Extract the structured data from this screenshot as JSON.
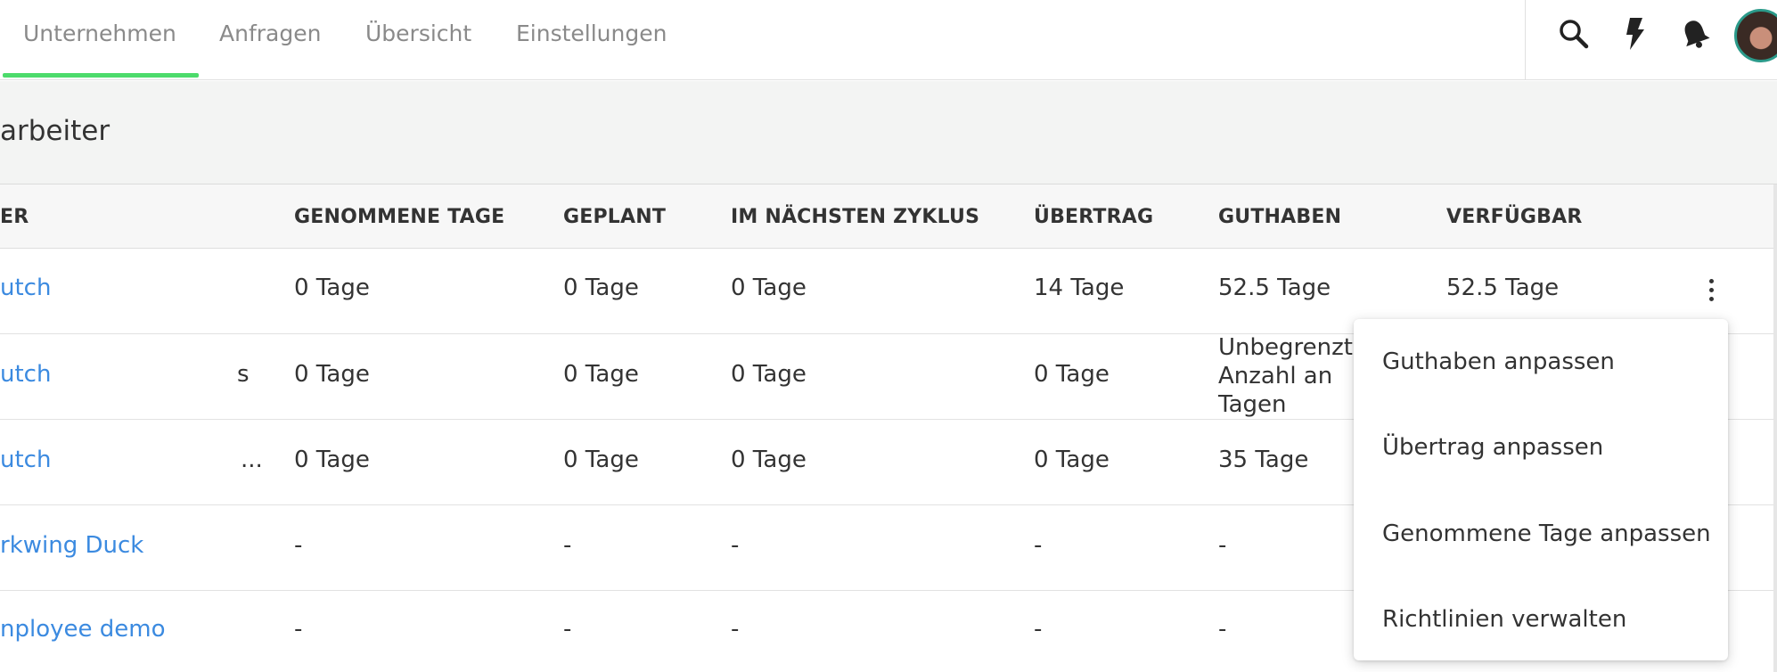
{
  "nav": {
    "tabs": [
      {
        "label": "Unternehmen"
      },
      {
        "label": "Anfragen"
      },
      {
        "label": "Übersicht"
      },
      {
        "label": "Einstellungen"
      }
    ],
    "active_tab": "Unternehmen",
    "accent_color": "#4cdb6b"
  },
  "header_icons": [
    "search-icon",
    "lightning-icon",
    "bell-icon"
  ],
  "section": {
    "title": "arbeiter"
  },
  "table": {
    "columns": [
      "ER",
      "GENOMMENE TAGE",
      "GEPLANT",
      "IM NÄCHSTEN ZYKLUS",
      "ÜBERTRAG",
      "GUTHABEN",
      "VERFÜGBAR"
    ],
    "rows": [
      {
        "name": "utch",
        "extra": "",
        "taken": "0 Tage",
        "planned": "0 Tage",
        "next_cycle": "0 Tage",
        "carryover": "14 Tage",
        "credit": "52.5 Tage",
        "available": "52.5 Tage"
      },
      {
        "name": "utch",
        "extra": "s",
        "taken": "0 Tage",
        "planned": "0 Tage",
        "next_cycle": "0 Tage",
        "carryover": "0 Tage",
        "credit": "Unbegrenzte Anzahl an Tagen",
        "available": ""
      },
      {
        "name": "utch",
        "extra": "...",
        "taken": "0 Tage",
        "planned": "0 Tage",
        "next_cycle": "0 Tage",
        "carryover": "0 Tage",
        "credit": "35 Tage",
        "available": ""
      },
      {
        "name": "rkwing Duck",
        "extra": "",
        "taken": "-",
        "planned": "-",
        "next_cycle": "-",
        "carryover": "-",
        "credit": "-",
        "available": ""
      },
      {
        "name": "nployee demo",
        "extra": "",
        "taken": "-",
        "planned": "-",
        "next_cycle": "-",
        "carryover": "-",
        "credit": "-",
        "available": ""
      }
    ],
    "link_color": "#3b8ae0"
  },
  "row_menu": {
    "items": [
      {
        "label": "Guthaben anpassen"
      },
      {
        "label": "Übertrag anpassen"
      },
      {
        "label": "Genommene Tage anpassen"
      },
      {
        "label": "Richtlinien verwalten"
      }
    ]
  }
}
